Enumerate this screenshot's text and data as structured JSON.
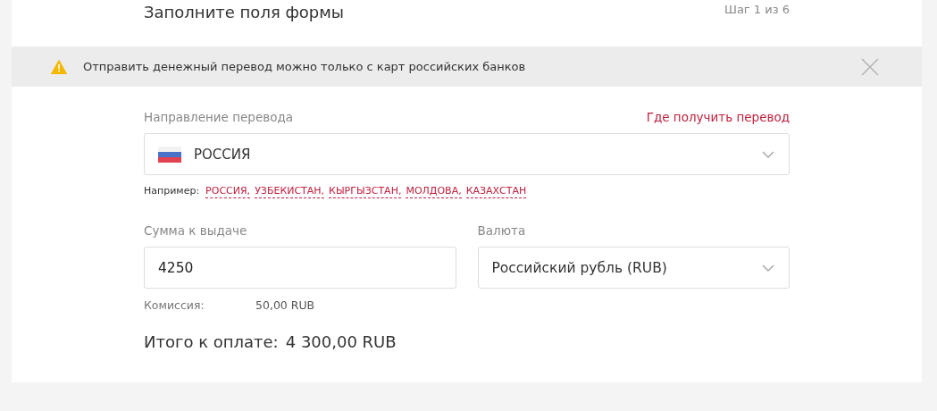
{
  "header": {
    "title": "Заполните поля формы",
    "step": "Шаг 1 из 6"
  },
  "notice": {
    "text": "Отправить денежный перевод можно только с карт российских банков"
  },
  "direction": {
    "label": "Направление перевода",
    "link": "Где получить перевод",
    "value": "РОССИЯ",
    "examples_label": "Например:",
    "examples": [
      "РОССИЯ,",
      "УЗБЕКИСТАН,",
      "КЫРГЫЗСТАН,",
      "МОЛДОВА,",
      "КАЗАХСТАН"
    ]
  },
  "amount": {
    "label": "Сумма к выдаче",
    "value": "4250"
  },
  "currency": {
    "label": "Валюта",
    "value": "Российский рубль (RUB)"
  },
  "commission": {
    "label": "Комиссия:",
    "value": "50,00 RUB"
  },
  "total": {
    "label": "Итого к оплате:",
    "value": "4 300,00 RUB"
  }
}
